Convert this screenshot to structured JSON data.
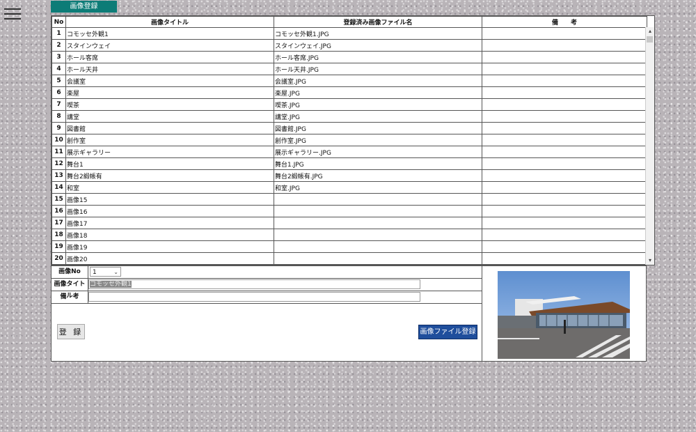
{
  "header": {
    "title": "画像登録",
    "menu_icon": "hamburger-menu-icon"
  },
  "grid": {
    "columns": [
      "No",
      "画像タイトル",
      "登録済み画像ファイル名",
      "備　　考"
    ],
    "rows": [
      {
        "no": "1",
        "title": "コモッセ外観1",
        "file": "コモッセ外観1.JPG",
        "note": ""
      },
      {
        "no": "2",
        "title": "スタインウェイ",
        "file": "スタインウェイ.JPG",
        "note": ""
      },
      {
        "no": "3",
        "title": "ホール客席",
        "file": "ホール客席.JPG",
        "note": ""
      },
      {
        "no": "4",
        "title": "ホール天井",
        "file": "ホール天井.JPG",
        "note": ""
      },
      {
        "no": "5",
        "title": "会議室",
        "file": "会議室.JPG",
        "note": ""
      },
      {
        "no": "6",
        "title": "楽屋",
        "file": "楽屋.JPG",
        "note": ""
      },
      {
        "no": "7",
        "title": "喫茶",
        "file": "喫茶.JPG",
        "note": ""
      },
      {
        "no": "8",
        "title": "講堂",
        "file": "講堂.JPG",
        "note": ""
      },
      {
        "no": "9",
        "title": "図書館",
        "file": "図書館.JPG",
        "note": ""
      },
      {
        "no": "10",
        "title": "創作室",
        "file": "創作室.JPG",
        "note": ""
      },
      {
        "no": "11",
        "title": "展示ギャラリー",
        "file": "展示ギャラリー.JPG",
        "note": ""
      },
      {
        "no": "12",
        "title": "舞台1",
        "file": "舞台1.JPG",
        "note": ""
      },
      {
        "no": "13",
        "title": "舞台2緞帳有",
        "file": "舞台2緞帳有.JPG",
        "note": ""
      },
      {
        "no": "14",
        "title": "和室",
        "file": "和室.JPG",
        "note": ""
      },
      {
        "no": "15",
        "title": "画像15",
        "file": "",
        "note": ""
      },
      {
        "no": "16",
        "title": "画像16",
        "file": "",
        "note": ""
      },
      {
        "no": "17",
        "title": "画像17",
        "file": "",
        "note": ""
      },
      {
        "no": "18",
        "title": "画像18",
        "file": "",
        "note": ""
      },
      {
        "no": "19",
        "title": "画像19",
        "file": "",
        "note": ""
      },
      {
        "no": "20",
        "title": "画像20",
        "file": "",
        "note": ""
      }
    ]
  },
  "form": {
    "no_label": "画像No",
    "no_value": "1",
    "title_label": "画像タイトル",
    "title_value": "コモッセ外観1",
    "note_label": "備　考",
    "note_value": "",
    "register_button": "登 録",
    "file_register_button": "画像ファイル登録"
  },
  "colors": {
    "title_tab": "#0d7c77",
    "file_button": "#1f4e9c"
  }
}
